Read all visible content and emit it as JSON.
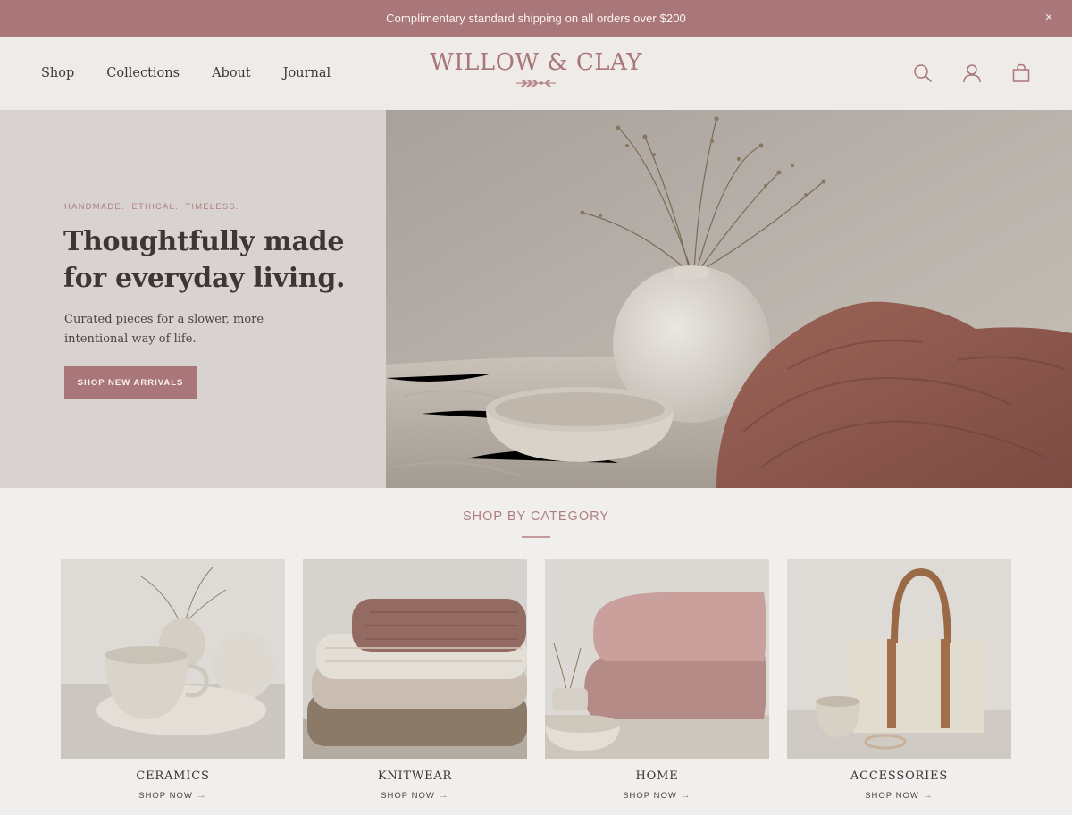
{
  "announcement": {
    "text": "Complimentary standard shipping on all orders over $200",
    "close_glyph": "×"
  },
  "header": {
    "nav": [
      {
        "label": "Shop"
      },
      {
        "label": "Collections"
      },
      {
        "label": "About"
      },
      {
        "label": "Journal"
      }
    ],
    "logo": "WILLOW & CLAY",
    "icons": [
      "search-icon",
      "account-icon",
      "shopping-bag-icon"
    ]
  },
  "hero": {
    "eyebrow": "HANDMADE.  ETHICAL.  TIMELESS.",
    "title": "Thoughtfully made for everyday living.",
    "subtitle": "Curated pieces for a slower, more intentional way of life.",
    "cta": "SHOP NEW ARRIVALS"
  },
  "categories": {
    "title": "SHOP BY CATEGORY",
    "items": [
      {
        "label": "CERAMICS",
        "link": "SHOP NOW"
      },
      {
        "label": "KNITWEAR",
        "link": "SHOP NOW"
      },
      {
        "label": "HOME",
        "link": "SHOP NOW"
      },
      {
        "label": "ACCESSORIES",
        "link": "SHOP NOW"
      }
    ],
    "arrow": "→"
  },
  "colors": {
    "accent": "#a9777a",
    "page_background": "#f1efed",
    "hero_panel": "#d8d3d0",
    "text": "#3c3434"
  }
}
